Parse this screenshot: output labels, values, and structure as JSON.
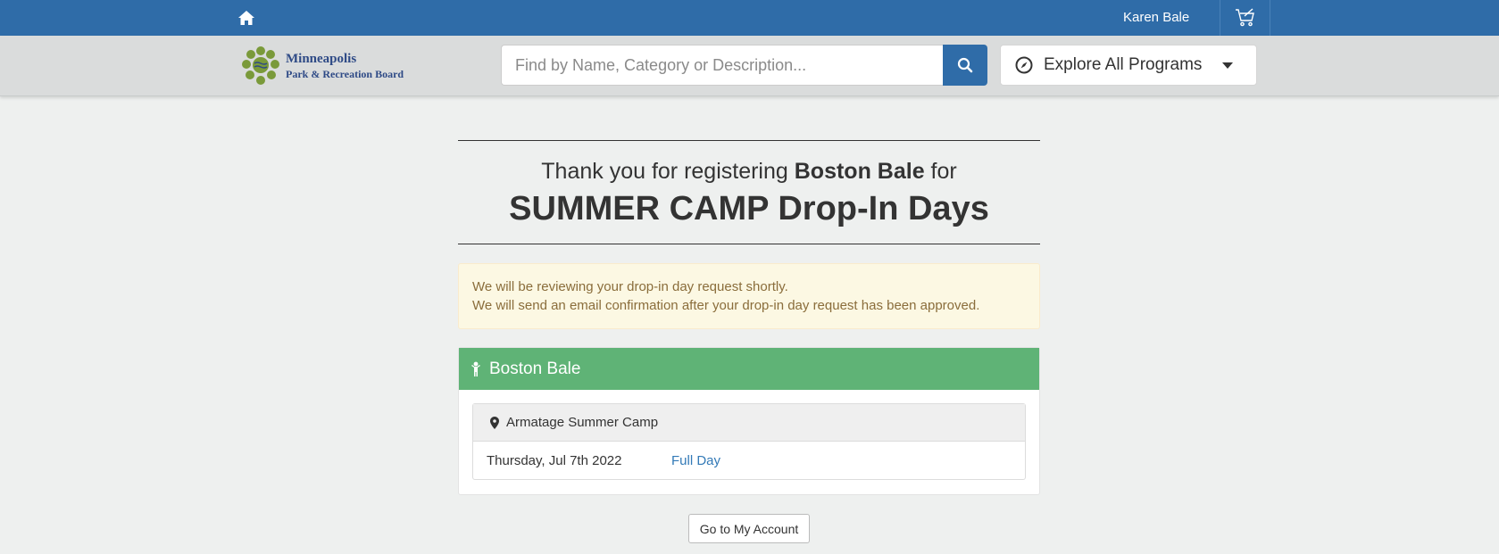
{
  "topbar": {
    "home_icon": "home-icon",
    "user_name": "Karen Bale",
    "cart_icon": "cart-icon"
  },
  "header": {
    "logo": {
      "line1": "Minneapolis",
      "line2": "Park & Recreation Board"
    },
    "search": {
      "placeholder": "Find by Name, Category or Description...",
      "value": "",
      "button_icon": "search-icon"
    },
    "explore": {
      "icon": "compass-icon",
      "label": "Explore All Programs",
      "caret_icon": "caret-down-icon"
    }
  },
  "confirmation": {
    "thanks_prefix": "Thank you for registering ",
    "participant": "Boston Bale",
    "thanks_suffix": " for",
    "program_title": "SUMMER CAMP Drop-In Days"
  },
  "alert": {
    "line1": "We will be reviewing your drop-in day request shortly.",
    "line2": "We will send an email confirmation after your drop-in day request has been approved."
  },
  "registration": {
    "participant_icon": "child-icon",
    "participant_name": "Boston Bale",
    "location_icon": "map-marker-icon",
    "location": "Armatage Summer Camp",
    "sessions": [
      {
        "date": "Thursday, Jul 7th 2022",
        "type": "Full Day"
      }
    ]
  },
  "actions": {
    "account_label": "Go to My Account"
  },
  "colors": {
    "topbar": "#2f6ca8",
    "header": "#dadcdc",
    "panel_head": "#5fb376",
    "alert_bg": "#fcf8e3",
    "alert_text": "#8a6d3b",
    "link": "#337ab7"
  }
}
